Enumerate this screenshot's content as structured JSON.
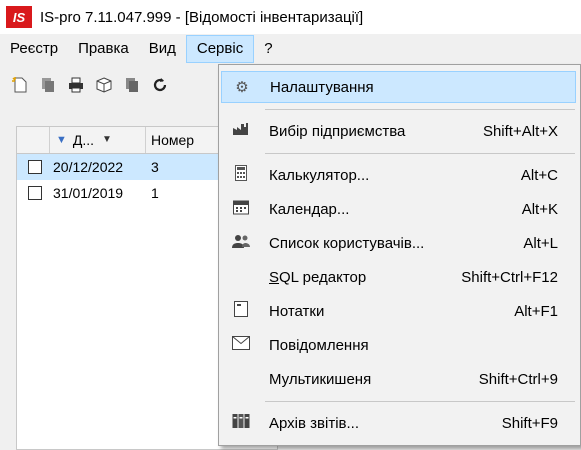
{
  "window": {
    "logo": "IS",
    "title": "IS-pro 7.11.047.999 - [Відомості інвентаризації]"
  },
  "menubar": [
    {
      "label": "Реєстр"
    },
    {
      "label": "Правка"
    },
    {
      "label": "Вид"
    },
    {
      "label": "Сервіс"
    },
    {
      "label": "?"
    }
  ],
  "toolbar": {
    "icons": [
      "new-document-icon",
      "copy-icon",
      "print-icon",
      "package-icon",
      "dark-copy-icon",
      "refresh-icon"
    ]
  },
  "grid": {
    "columns": {
      "date": "Д...",
      "number": "Номер"
    },
    "rows": [
      {
        "date": "20/12/2022",
        "number": "3",
        "selected": true
      },
      {
        "date": "31/01/2019",
        "number": "1",
        "selected": false
      }
    ]
  },
  "service_menu": {
    "items": [
      {
        "label": "Налаштування",
        "shortcut": "",
        "icon": "gears-icon"
      },
      {
        "label": "Вибір підприємства",
        "shortcut": "Shift+Alt+X",
        "icon": "factory-icon"
      },
      {
        "label": "Калькулятор...",
        "shortcut": "Alt+C",
        "icon": "calculator-icon"
      },
      {
        "label": "Календар...",
        "shortcut": "Alt+K",
        "icon": "calendar-icon"
      },
      {
        "label": "Список користувачів...",
        "shortcut": "Alt+L",
        "icon": "users-icon"
      },
      {
        "label": "SQL редактор",
        "shortcut": "Shift+Ctrl+F12",
        "icon": ""
      },
      {
        "label": "Нотатки",
        "shortcut": "Alt+F1",
        "icon": "note-icon"
      },
      {
        "label": "Повідомлення",
        "shortcut": "",
        "icon": "mail-icon"
      },
      {
        "label": "Мультикишеня",
        "shortcut": "Shift+Ctrl+9",
        "icon": ""
      },
      {
        "label": "Архів звітів...",
        "shortcut": "Shift+F9",
        "icon": "archive-icon"
      }
    ]
  }
}
